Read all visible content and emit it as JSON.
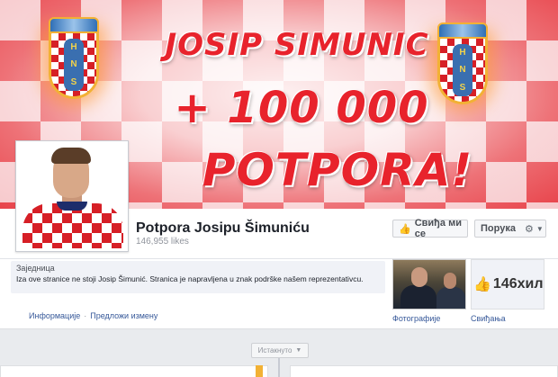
{
  "cover": {
    "line1": "JOSIP SIMUNIC",
    "line2": "+ 100 000",
    "line3": "POTPORA!",
    "crest_letters": [
      "H",
      "N",
      "S"
    ],
    "colors": {
      "red": "#e8232c",
      "checker_light": "#f7c9cc",
      "gold": "#f2b134"
    }
  },
  "page": {
    "name": "Potpora Josipu Šimuniću",
    "likes": "146,955 likes"
  },
  "actions": {
    "like_label": "Свиђа ми се",
    "message_label": "Порука"
  },
  "about": {
    "category": "Заједница",
    "description": "Iza ove stranice ne stoji Josip Šimunić. Stranica je napravljena u znak podrške našem reprezentativcu.",
    "info_link": "Информације",
    "edit_link": "Предложи измену"
  },
  "apps": {
    "photos_label": "Фотографије",
    "likes_label": "Свиђања",
    "likes_count": "146хил"
  },
  "timeline": {
    "highlights_label": "Истакнуто"
  },
  "colors": {
    "link": "#365899",
    "brand": "#4267b2"
  }
}
